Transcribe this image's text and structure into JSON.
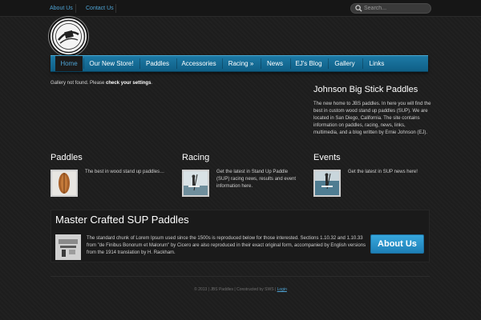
{
  "topbar": {
    "links": [
      "About Us",
      "Contact Us"
    ],
    "search_placeholder": "Search..."
  },
  "nav": {
    "items": [
      "Home",
      "Our New Store!",
      "Paddles",
      "Accessories",
      "Racing »",
      "News",
      "EJ's Blog",
      "Gallery",
      "Links"
    ],
    "active": "Home"
  },
  "notice": {
    "text": "Gallery not found. Please ",
    "link": "check your settings",
    "end": "."
  },
  "sidebar": {
    "title": "Johnson Big Stick Paddles",
    "text": "The new home to JBS paddles. In here you will find the best in custom wood stand up paddles (SUP). We are located in San Diego, California. The site contains information on paddles, racing, news, links, multimedia, and a blog written by Ernie Johnson (EJ)."
  },
  "columns": [
    {
      "title": "Paddles",
      "text": "The best in wood stand up paddles…",
      "icon": "paddle-photo"
    },
    {
      "title": "Racing",
      "text": "Get the latest in Stand Up Paddle (SUP) racing news, results and event information here.",
      "icon": "racing-photo"
    },
    {
      "title": "Events",
      "text": "Get the latest in SUP news here!",
      "icon": "events-photo"
    }
  ],
  "master": {
    "title": "Master Crafted SUP Paddles",
    "text": "The standard chunk of Lorem Ipsum used since the 1500s is reproduced below for those interested. Sections 1.10.32 and 1.10.33 from \"de Finibus Bonorum et Malorum\" by Cicero are also reproduced in their exact original form, accompanied by English versions from the 1914 translation by H. Rackham.",
    "button": "About Us"
  },
  "footer": {
    "text": "© 2013 | JBS Paddles | Constructed by SWS | ",
    "login": "Login"
  },
  "colors": {
    "accent": "#1d7aa6",
    "link": "#4ea3d4",
    "background": "#1e1e1e"
  }
}
